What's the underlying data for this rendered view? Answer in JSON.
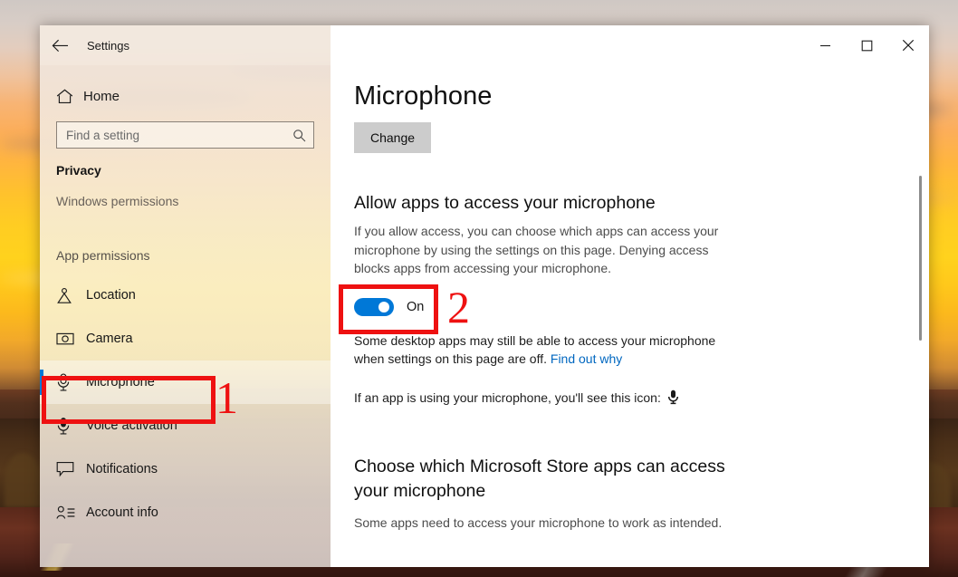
{
  "window": {
    "titlebar": {
      "back_icon": "back-arrow-icon",
      "title": "Settings",
      "minimize_label": "Minimize",
      "maximize_label": "Maximize",
      "close_label": "Close"
    }
  },
  "sidebar": {
    "home": {
      "label": "Home",
      "icon": "home-icon"
    },
    "search": {
      "placeholder": "Find a setting",
      "value": "",
      "icon": "search-icon"
    },
    "section_title": "Privacy",
    "groups": [
      {
        "label": "Windows permissions"
      },
      {
        "label": "App permissions"
      }
    ],
    "items": [
      {
        "label": "Location",
        "icon": "location-pin-icon",
        "selected": false
      },
      {
        "label": "Camera",
        "icon": "camera-icon",
        "selected": false
      },
      {
        "label": "Microphone",
        "icon": "microphone-outline-icon",
        "selected": true
      },
      {
        "label": "Voice activation",
        "icon": "microphone-filled-icon",
        "selected": false
      },
      {
        "label": "Notifications",
        "icon": "speech-bubble-icon",
        "selected": false
      },
      {
        "label": "Account info",
        "icon": "account-info-icon",
        "selected": false
      }
    ]
  },
  "main": {
    "page_title": "Microphone",
    "change_button": "Change",
    "allow_section": {
      "heading": "Allow apps to access your microphone",
      "description": "If you allow access, you can choose which apps can access your microphone by using the settings on this page. Denying access blocks apps from accessing your microphone.",
      "toggle": {
        "state_label": "On",
        "checked": true,
        "accent": "#0078d7"
      },
      "desktop_note_text": "Some desktop apps may still be able to access your microphone when settings on this page are off.",
      "desktop_note_link": "Find out why",
      "icon_note_text": "If an app is using your microphone, you'll see this icon:",
      "icon_note_icon": "microphone-filled-icon"
    },
    "store_section": {
      "heading": "Choose which Microsoft Store apps can access your microphone",
      "description": "Some apps need to access your microphone to work as intended."
    },
    "scrollbar": {
      "name": "vertical-scrollbar"
    }
  },
  "annotations": {
    "accent_color": "#ee1111",
    "markers": [
      {
        "number": "1",
        "target": "sidebar-item-microphone"
      },
      {
        "number": "2",
        "target": "microphone-access-toggle"
      }
    ]
  }
}
